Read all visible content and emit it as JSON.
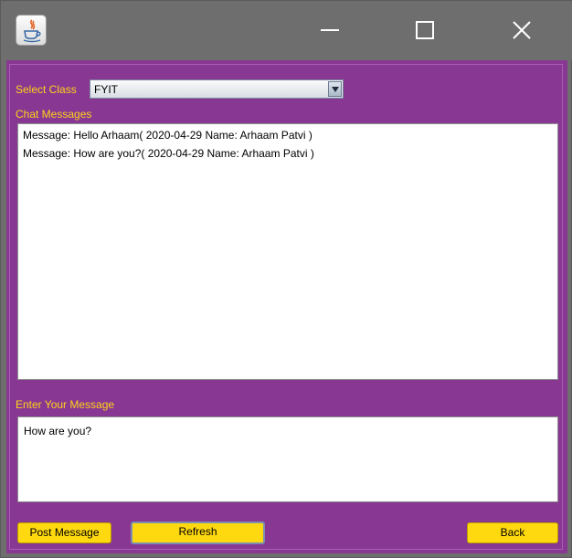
{
  "window": {
    "icon": "java-cup-icon",
    "controls": [
      "minimize-icon",
      "maximize-icon",
      "close-icon"
    ]
  },
  "form": {
    "select_class_label": "Select Class",
    "select_class_value": "FYIT",
    "chat_messages_label": "Chat Messages",
    "messages": [
      "Message: Hello Arhaam( 2020-04-29 Name: Arhaam Patvi )",
      "Message: How are you?( 2020-04-29 Name: Arhaam Patvi )"
    ],
    "enter_message_label": "Enter Your Message",
    "message_input_value": "How are you?"
  },
  "buttons": {
    "post": "Post Message",
    "refresh": "Refresh",
    "back": "Back"
  },
  "colors": {
    "panel_background": "#883892",
    "label_text": "#ffd21a",
    "button_background": "#ffd90f",
    "title_bar": "#6e6e6e"
  }
}
